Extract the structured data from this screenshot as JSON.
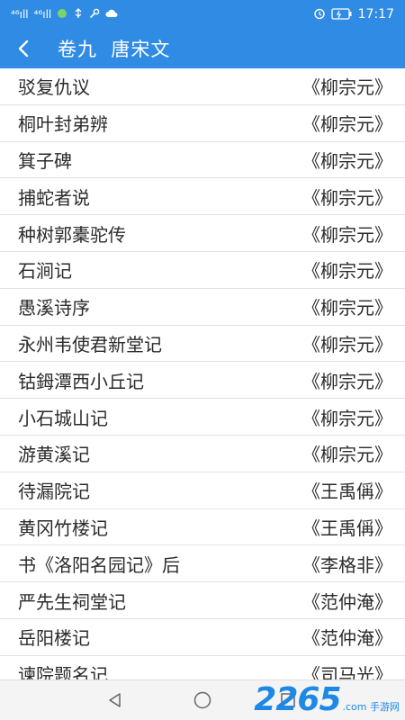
{
  "status_bar": {
    "signal1": "⁴⁶ıll",
    "signal2": "⁴⁶ıll",
    "time": "17:17"
  },
  "header": {
    "title": "卷九  唐宋文"
  },
  "items": [
    {
      "title": "驳复仇议",
      "author": "《柳宗元》"
    },
    {
      "title": "桐叶封弟辨",
      "author": "《柳宗元》"
    },
    {
      "title": "箕子碑",
      "author": "《柳宗元》"
    },
    {
      "title": "捕蛇者说",
      "author": "《柳宗元》"
    },
    {
      "title": "种树郭橐驼传",
      "author": "《柳宗元》"
    },
    {
      "title": "石涧记",
      "author": "《柳宗元》"
    },
    {
      "title": "愚溪诗序",
      "author": "《柳宗元》"
    },
    {
      "title": "永州韦使君新堂记",
      "author": "《柳宗元》"
    },
    {
      "title": "钴鉧潭西小丘记",
      "author": "《柳宗元》"
    },
    {
      "title": "小石城山记",
      "author": "《柳宗元》"
    },
    {
      "title": "游黄溪记",
      "author": "《柳宗元》"
    },
    {
      "title": "待漏院记",
      "author": "《王禹偁》"
    },
    {
      "title": "黄冈竹楼记",
      "author": "《王禹偁》"
    },
    {
      "title": "书《洛阳名园记》后",
      "author": "《李格非》"
    },
    {
      "title": "严先生祠堂记",
      "author": "《范仲淹》"
    },
    {
      "title": "岳阳楼记",
      "author": "《范仲淹》"
    },
    {
      "title": "谏院题名记",
      "author": "《司马光》"
    }
  ],
  "watermark": {
    "main": "2265",
    "sub": ".com 手游网"
  },
  "colors": {
    "accent": "#2f8be3",
    "divider": "#e2e2e2",
    "text": "#2b2b2b"
  }
}
